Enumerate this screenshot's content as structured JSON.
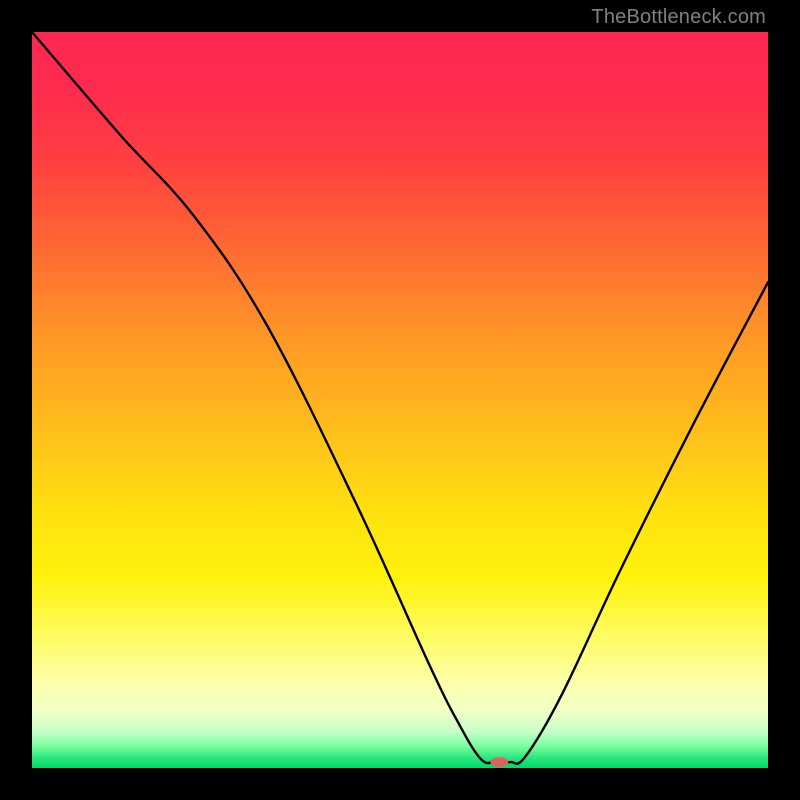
{
  "watermark": "TheBottleneck.com",
  "chart_data": {
    "type": "line",
    "title": "",
    "xlabel": "",
    "ylabel": "",
    "xlim": [
      0,
      100
    ],
    "ylim": [
      0,
      100
    ],
    "grid": false,
    "series": [
      {
        "name": "bottleneck-curve",
        "x": [
          0,
          12,
          22,
          32,
          44,
          54,
          58,
          61,
          63,
          65,
          67,
          72,
          80,
          90,
          100
        ],
        "values": [
          100,
          86,
          75,
          60,
          36,
          14,
          6,
          1.2,
          0.8,
          0.8,
          1.5,
          10,
          27,
          47,
          66
        ]
      }
    ],
    "marker": {
      "name": "optimal-point",
      "x": 63.5,
      "y": 0.8,
      "color": "#e16060",
      "rx": 9,
      "ry": 5
    },
    "background_gradient_stops": [
      {
        "offset": 0.0,
        "color": "#ff2750"
      },
      {
        "offset": 0.5,
        "color": "#ffc11a"
      },
      {
        "offset": 0.8,
        "color": "#fffc60"
      },
      {
        "offset": 1.0,
        "color": "#00d968"
      }
    ]
  }
}
